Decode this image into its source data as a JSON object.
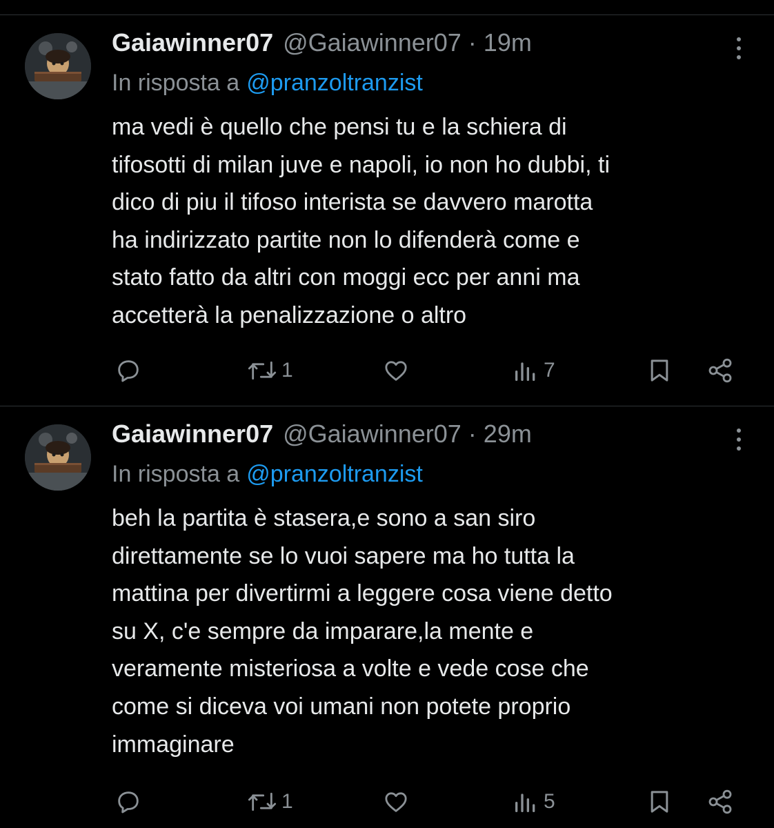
{
  "colors": {
    "background": "#000000",
    "text": "#e7e9ea",
    "muted": "#8b9196",
    "link": "#1d9bf0",
    "divider": "#2f3336"
  },
  "tweets": [
    {
      "display_name": "Gaiawinner07",
      "handle": "@Gaiawinner07",
      "separator": "·",
      "time": "19m",
      "reply_prefix": "In risposta a",
      "reply_handle": "@pranzoltranzist",
      "text": "ma vedi è quello che pensi tu e la schiera di\ntifosotti di milan juve e napoli, io non ho dubbi, ti\ndico di piu il tifoso interista se davvero marotta\nha indirizzato partite non lo difenderà come e\nstato fatto da altri con moggi ecc per anni ma\naccetterà la penalizzazione o altro",
      "replies": "",
      "reposts": "1",
      "likes": "",
      "views": "7",
      "icons": [
        "reply-icon",
        "repost-icon",
        "like-icon",
        "views-icon",
        "bookmark-icon",
        "share-icon",
        "more-icon"
      ]
    },
    {
      "display_name": "Gaiawinner07",
      "handle": "@Gaiawinner07",
      "separator": "·",
      "time": "29m",
      "reply_prefix": "In risposta a",
      "reply_handle": "@pranzoltranzist",
      "text": "beh la partita è stasera,e sono a san siro\ndirettamente se lo vuoi sapere ma ho tutta la\nmattina per divertirmi a leggere cosa viene detto\nsu X, c'e sempre da imparare,la mente  e\nveramente misteriosa a volte e vede cose che\ncome si diceva voi umani non potete proprio\nimmaginare",
      "replies": "",
      "reposts": "1",
      "likes": "",
      "views": "5",
      "icons": [
        "reply-icon",
        "repost-icon",
        "like-icon",
        "views-icon",
        "bookmark-icon",
        "share-icon",
        "more-icon"
      ]
    }
  ]
}
